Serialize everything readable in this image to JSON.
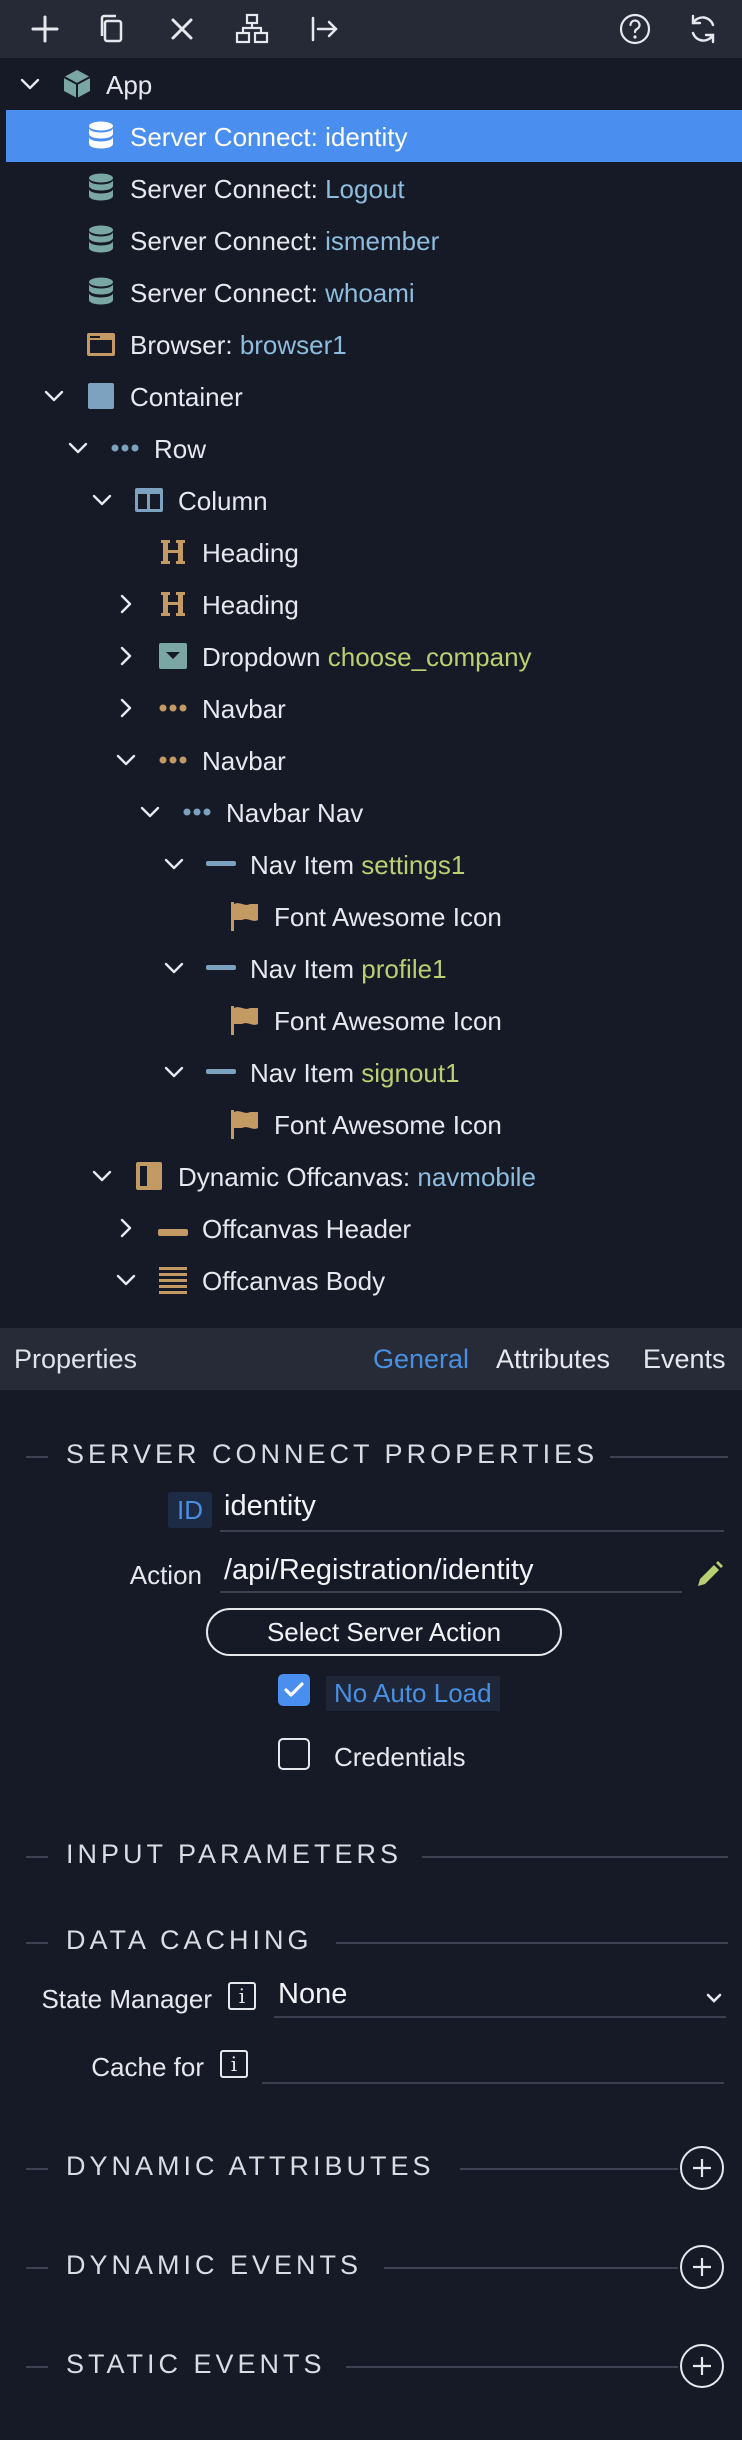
{
  "toolbar": {
    "icons": [
      "plus-icon",
      "copy-icon",
      "close-icon",
      "hierarchy-icon",
      "move-right-icon",
      "help-icon",
      "refresh-icon"
    ]
  },
  "tree": [
    {
      "key": "App",
      "value": "",
      "vcolor": "",
      "icon": "cube-icon"
    },
    {
      "key": "Server Connect: ",
      "value": "identity",
      "vcolor": "blue",
      "icon": "database-icon"
    },
    {
      "key": "Server Connect: ",
      "value": "Logout",
      "vcolor": "blue",
      "icon": "database-icon"
    },
    {
      "key": "Server Connect: ",
      "value": "ismember",
      "vcolor": "blue",
      "icon": "database-icon"
    },
    {
      "key": "Server Connect: ",
      "value": "whoami",
      "vcolor": "blue",
      "icon": "database-icon"
    },
    {
      "key": "Browser: ",
      "value": "browser1",
      "vcolor": "blue",
      "icon": "browser-icon"
    },
    {
      "key": "Container",
      "value": "",
      "vcolor": "",
      "icon": "container-icon"
    },
    {
      "key": "Row",
      "value": "",
      "vcolor": "",
      "icon": "dots-icon"
    },
    {
      "key": "Column",
      "value": "",
      "vcolor": "",
      "icon": "column-icon"
    },
    {
      "key": "Heading",
      "value": "",
      "vcolor": "",
      "icon": "heading-icon"
    },
    {
      "key": "Heading",
      "value": "",
      "vcolor": "",
      "icon": "heading-icon"
    },
    {
      "key": "Dropdown ",
      "value": "choose_company",
      "vcolor": "green",
      "icon": "dropdown-icon"
    },
    {
      "key": "Navbar",
      "value": "",
      "vcolor": "",
      "icon": "dots-icon"
    },
    {
      "key": "Navbar",
      "value": "",
      "vcolor": "",
      "icon": "dots-icon"
    },
    {
      "key": "Navbar Nav",
      "value": "",
      "vcolor": "",
      "icon": "dots-icon"
    },
    {
      "key": "Nav Item ",
      "value": "settings1",
      "vcolor": "green",
      "icon": "dash-icon"
    },
    {
      "key": "Font Awesome Icon",
      "value": "",
      "vcolor": "",
      "icon": "flag-icon"
    },
    {
      "key": "Nav Item ",
      "value": "profile1",
      "vcolor": "green",
      "icon": "dash-icon"
    },
    {
      "key": "Font Awesome Icon",
      "value": "",
      "vcolor": "",
      "icon": "flag-icon"
    },
    {
      "key": "Nav Item ",
      "value": "signout1",
      "vcolor": "green",
      "icon": "dash-icon"
    },
    {
      "key": "Font Awesome Icon",
      "value": "",
      "vcolor": "",
      "icon": "flag-icon"
    },
    {
      "key": "Dynamic Offcanvas: ",
      "value": "navmobile",
      "vcolor": "blue",
      "icon": "offcanvas-icon"
    },
    {
      "key": "Offcanvas Header",
      "value": "",
      "vcolor": "",
      "icon": "header-bar-icon"
    },
    {
      "key": "Offcanvas Body",
      "value": "",
      "vcolor": "",
      "icon": "lines-icon"
    }
  ],
  "props": {
    "title": "Properties",
    "tabs": [
      "General",
      "Attributes",
      "Events"
    ],
    "active_tab": "General"
  },
  "sections": {
    "server_connect": "SERVER CONNECT PROPERTIES",
    "input_params": "INPUT PARAMETERS",
    "data_caching": "DATA CACHING",
    "dynamic_attrs": "DYNAMIC ATTRIBUTES",
    "dynamic_events": "DYNAMIC EVENTS",
    "static_events": "STATIC EVENTS"
  },
  "fields": {
    "id_label": "ID",
    "id_value": "identity",
    "action_label": "Action",
    "action_value": "/api/Registration/identity",
    "select_action_button": "Select Server Action",
    "no_auto_load": "No Auto Load",
    "no_auto_load_checked": true,
    "credentials": "Credentials",
    "credentials_checked": false,
    "state_manager_label": "State Manager",
    "state_manager_value": "None",
    "cache_for_label": "Cache for",
    "cache_for_value": "",
    "info_glyph": "i"
  },
  "colors": {
    "accent": "#4a8ef0",
    "value_blue": "#8dbcdc",
    "value_green": "#b8cf72",
    "icon_tan": "#c49a64",
    "icon_teal": "#7aa7a4"
  }
}
